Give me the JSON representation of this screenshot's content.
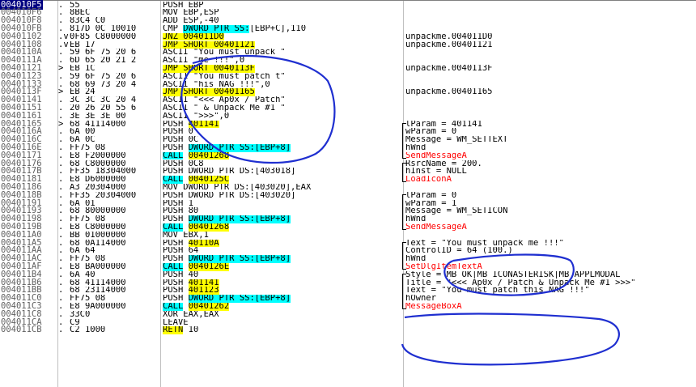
{
  "rows": [
    {
      "addr": "004010F5",
      "mark": ".",
      "hex": "55",
      "ins": "PUSH EBP",
      "cmt": "",
      "selected": true
    },
    {
      "addr": "004010F6",
      "mark": ".",
      "hex": "8BEC",
      "ins": "MOV EBP,ESP",
      "cmt": ""
    },
    {
      "addr": "004010F8",
      "mark": ".",
      "hex": "83C4 C0",
      "ins": "ADD ESP,-40",
      "cmt": ""
    },
    {
      "addr": "004010FB",
      "mark": ".",
      "hex": "817D 0C 10010",
      "ins": "CMP DWORD PTR SS:[EBP+C],110",
      "cmt": ""
    },
    {
      "addr": "00401102",
      "mark": ".v",
      "hex": "0F85 C8000000",
      "ins": "JNZ 004011D0",
      "cmt": "unpackme.004011D0"
    },
    {
      "addr": "00401108",
      "mark": ".v",
      "hex": "EB 17",
      "ins": "JMP SHORT 00401121",
      "cmt": "unpackme.00401121"
    },
    {
      "addr": "0040110A",
      "mark": ".",
      "hex": "59 6F 75 20 6",
      "ins": "ASCII \"You must unpack \"",
      "cmt": ""
    },
    {
      "addr": "0040111A",
      "mark": ".",
      "hex": "6D 65 20 21 2",
      "ins": "ASCII \"me !!!\",0",
      "cmt": ""
    },
    {
      "addr": "00401121",
      "mark": ">",
      "hex": "EB 1C",
      "ins": "JMP SHORT 0040113F",
      "cmt": "unpackme.0040113F"
    },
    {
      "addr": "00401123",
      "mark": ".",
      "hex": "59 6F 75 20 6",
      "ins": "ASCII \"You must patch t\"",
      "cmt": ""
    },
    {
      "addr": "00401133",
      "mark": ".",
      "hex": "68 69 73 20 4",
      "ins": "ASCII \"his NAG !!!\",0",
      "cmt": ""
    },
    {
      "addr": "0040113F",
      "mark": ">",
      "hex": "EB 24",
      "ins": "JMP SHORT 00401165",
      "cmt": "unpackme.00401165"
    },
    {
      "addr": "00401141",
      "mark": ".",
      "hex": "3C 3C 3C 20 4",
      "ins": "ASCII \"<<< Ap0x / Patch\"",
      "cmt": ""
    },
    {
      "addr": "00401151",
      "mark": ".",
      "hex": "20 26 20 55 6",
      "ins": "ASCII \" & Unpack Me #1 \"",
      "cmt": ""
    },
    {
      "addr": "00401161",
      "mark": ".",
      "hex": "3E 3E 3E 00",
      "ins": "ASCII \">>>\",0",
      "cmt": ""
    },
    {
      "addr": "00401165",
      "mark": ">",
      "hex": "68 41114000",
      "ins": "PUSH 401141",
      "cmt": "lParam = 401141"
    },
    {
      "addr": "0040116A",
      "mark": ".",
      "hex": "6A 00",
      "ins": "PUSH 0",
      "cmt": "wParam = 0"
    },
    {
      "addr": "0040116C",
      "mark": ".",
      "hex": "6A 0C",
      "ins": "PUSH 0C",
      "cmt": "Message = WM_SETTEXT"
    },
    {
      "addr": "0040116E",
      "mark": ".",
      "hex": "FF75 08",
      "ins": "PUSH DWORD PTR SS:[EBP+8]",
      "cmt": "hWnd"
    },
    {
      "addr": "00401171",
      "mark": ".",
      "hex": "E8 F2000000",
      "ins": "CALL 00401268",
      "cmt": "SendMessageA"
    },
    {
      "addr": "00401176",
      "mark": ".",
      "hex": "68 C8000000",
      "ins": "PUSH 0C8",
      "cmt": "RsrcName = 200."
    },
    {
      "addr": "0040117B",
      "mark": ".",
      "hex": "FF35 18304000",
      "ins": "PUSH DWORD PTR DS:[403018]",
      "cmt": "hInst = NULL"
    },
    {
      "addr": "00401181",
      "mark": ".",
      "hex": "E8 D6000000",
      "ins": "CALL 0040125C",
      "cmt": "LoadIconA"
    },
    {
      "addr": "00401186",
      "mark": ".",
      "hex": "A3 20304000",
      "ins": "MOV DWORD PTR DS:[403020],EAX",
      "cmt": ""
    },
    {
      "addr": "0040118B",
      "mark": ".",
      "hex": "FF35 20304000",
      "ins": "PUSH DWORD PTR DS:[403020]",
      "cmt": "lParam = 0"
    },
    {
      "addr": "00401191",
      "mark": ".",
      "hex": "6A 01",
      "ins": "PUSH 1",
      "cmt": "wParam = 1"
    },
    {
      "addr": "00401193",
      "mark": ".",
      "hex": "68 80000000",
      "ins": "PUSH 80",
      "cmt": "Message = WM_SETICON"
    },
    {
      "addr": "00401198",
      "mark": ".",
      "hex": "FF75 08",
      "ins": "PUSH DWORD PTR SS:[EBP+8]",
      "cmt": "hWnd"
    },
    {
      "addr": "0040119B",
      "mark": ".",
      "hex": "E8 C8000000",
      "ins": "CALL 00401268",
      "cmt": "SendMessageA"
    },
    {
      "addr": "004011A0",
      "mark": ".",
      "hex": "BB 01000000",
      "ins": "MOV EBX,1",
      "cmt": ""
    },
    {
      "addr": "004011A5",
      "mark": ".",
      "hex": "68 0A114000",
      "ins": "PUSH 40110A",
      "cmt": "Text = \"You must unpack me !!!\""
    },
    {
      "addr": "004011AA",
      "mark": ".",
      "hex": "6A 64",
      "ins": "PUSH 64",
      "cmt": "ControlID = 64 (100.)"
    },
    {
      "addr": "004011AC",
      "mark": ".",
      "hex": "FF75 08",
      "ins": "PUSH DWORD PTR SS:[EBP+8]",
      "cmt": "hWnd"
    },
    {
      "addr": "004011AF",
      "mark": ".",
      "hex": "E8 BA000000",
      "ins": "CALL 0040126E",
      "cmt": "SetDlgItemTextA"
    },
    {
      "addr": "004011B4",
      "mark": ".",
      "hex": "6A 40",
      "ins": "PUSH 40",
      "cmt": "Style = MB_OK|MB_ICONASTERISK|MB_APPLMODAL"
    },
    {
      "addr": "004011B6",
      "mark": ".",
      "hex": "68 41114000",
      "ins": "PUSH 401141",
      "cmt": "Title = \"<<< Ap0x / Patch & Unpack Me #1 >>>\""
    },
    {
      "addr": "004011BB",
      "mark": ".",
      "hex": "68 23114000",
      "ins": "PUSH 401123",
      "cmt": "Text = \"You must patch this NAG !!!\""
    },
    {
      "addr": "004011C0",
      "mark": ".",
      "hex": "FF75 08",
      "ins": "PUSH DWORD PTR SS:[EBP+8]",
      "cmt": "hOwner"
    },
    {
      "addr": "004011C3",
      "mark": ".",
      "hex": "E8 9A000000",
      "ins": "CALL 00401262",
      "cmt": "MessageBoxA"
    },
    {
      "addr": "004011C8",
      "mark": ".",
      "hex": "33C0",
      "ins": "XOR EAX,EAX",
      "cmt": ""
    },
    {
      "addr": "004011CA",
      "mark": ".",
      "hex": "C9",
      "ins": "LEAVE",
      "cmt": ""
    },
    {
      "addr": "004011CB",
      "mark": ".",
      "hex": "C2 1000",
      "ins": "RETN 10",
      "cmt": ""
    }
  ],
  "colors": {
    "jump_highlight": "#ffff00",
    "call_highlight": "#00ffff",
    "api_name": "#ff0000",
    "ink_annotation": "#1f2fd0",
    "selection": "#000080"
  }
}
